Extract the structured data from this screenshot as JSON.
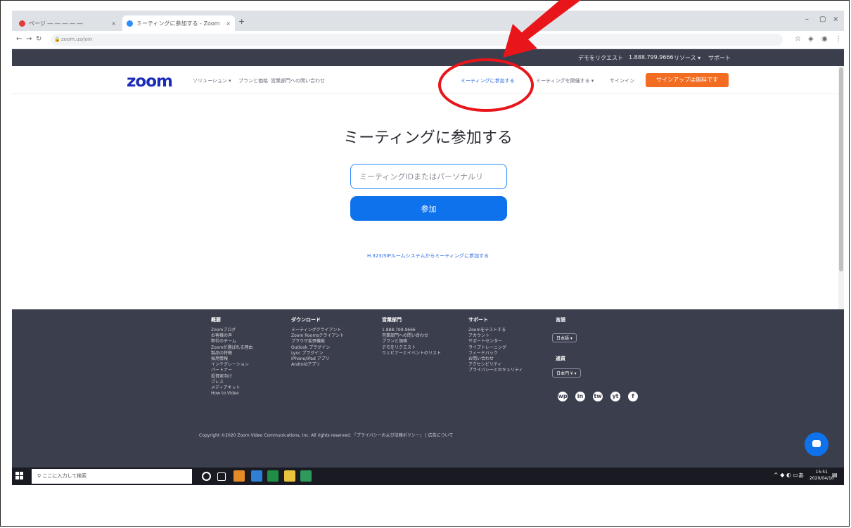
{
  "browser": {
    "tabs": [
      {
        "title": "ページ ―  ― ― ― ―",
        "color": "#e23b3b"
      },
      {
        "title": "ミーティングに参加する - Zoom",
        "color": "#2d8cff"
      }
    ],
    "new_tab": "+",
    "url": "zoom.us/join",
    "window_controls": [
      "–",
      "▢",
      "×"
    ]
  },
  "topbar": {
    "links": [
      "デモをリクエスト",
      "1.888.799.9666",
      "リソース ▾",
      "サポート"
    ]
  },
  "nav": {
    "logo": "zoom",
    "left_links": [
      "ソリューション ▾",
      "プランと価格",
      "営業部門への問い合わせ"
    ],
    "right_links": [
      "ミーティングに参加する",
      "ミーティングを開催する ▾",
      "サインイン"
    ],
    "signup": "サインアップは無料です"
  },
  "main": {
    "heading": "ミーティングに参加する",
    "input_placeholder": "ミーティングIDまたはパーソナルリ",
    "join_button": "参加",
    "h323_link": "H.323/SIPルームシステムからミーティングに参加する"
  },
  "footer": {
    "columns": [
      {
        "title": "概要",
        "items": [
          "Zoomブログ",
          "お客様の声",
          "弊社のチーム",
          "Zoomが選ばれる理由",
          "製品の特徴",
          "採用情報",
          "インテグレーション",
          "パートナー",
          "投資家向け",
          "プレス",
          "メディアキット",
          "How to Video"
        ]
      },
      {
        "title": "ダウンロード",
        "items": [
          "ミーティングクライアント",
          "Zoom Roomsクライアント",
          "ブラウザ拡張機能",
          "Outlook プラグイン",
          "Lync プラグイン",
          "iPhone/iPad アプリ",
          "Androidアプリ"
        ]
      },
      {
        "title": "営業部門",
        "items": [
          "1.888.799.9666",
          "営業部門への問い合わせ",
          "プランと価格",
          "デモをリクエスト",
          "ウェビナーとイベントのリスト"
        ]
      },
      {
        "title": "サポート",
        "items": [
          "Zoomをテストする",
          "アカウント",
          "サポートセンター",
          "ライブトレーニング",
          "フィードバック",
          "お問い合わせ",
          "アクセシビリティ",
          "プライバシーとセキュリティ"
        ]
      }
    ],
    "language_label": "言語",
    "language_value": "日本語 ▾",
    "currency_label": "通貨",
    "currency_value": "日本円 ¥ ▾",
    "social": [
      "wp",
      "in",
      "tw",
      "yt",
      "f"
    ],
    "copyright": "Copyright ©2020 Zoom Video Communications, Inc. All rights reserved.  「プライバシーおよび法務ポリシー」 | 広告について"
  },
  "taskbar": {
    "search_placeholder": "ここに入力して検索",
    "clock_time": "15:51",
    "clock_date": "2020/04/10",
    "ime": "あ"
  },
  "colors": {
    "annotation": "#e8151b",
    "zoom_blue": "#0e72ed",
    "signup_orange": "#f26d21",
    "dark_bar": "#3b3e4d"
  }
}
